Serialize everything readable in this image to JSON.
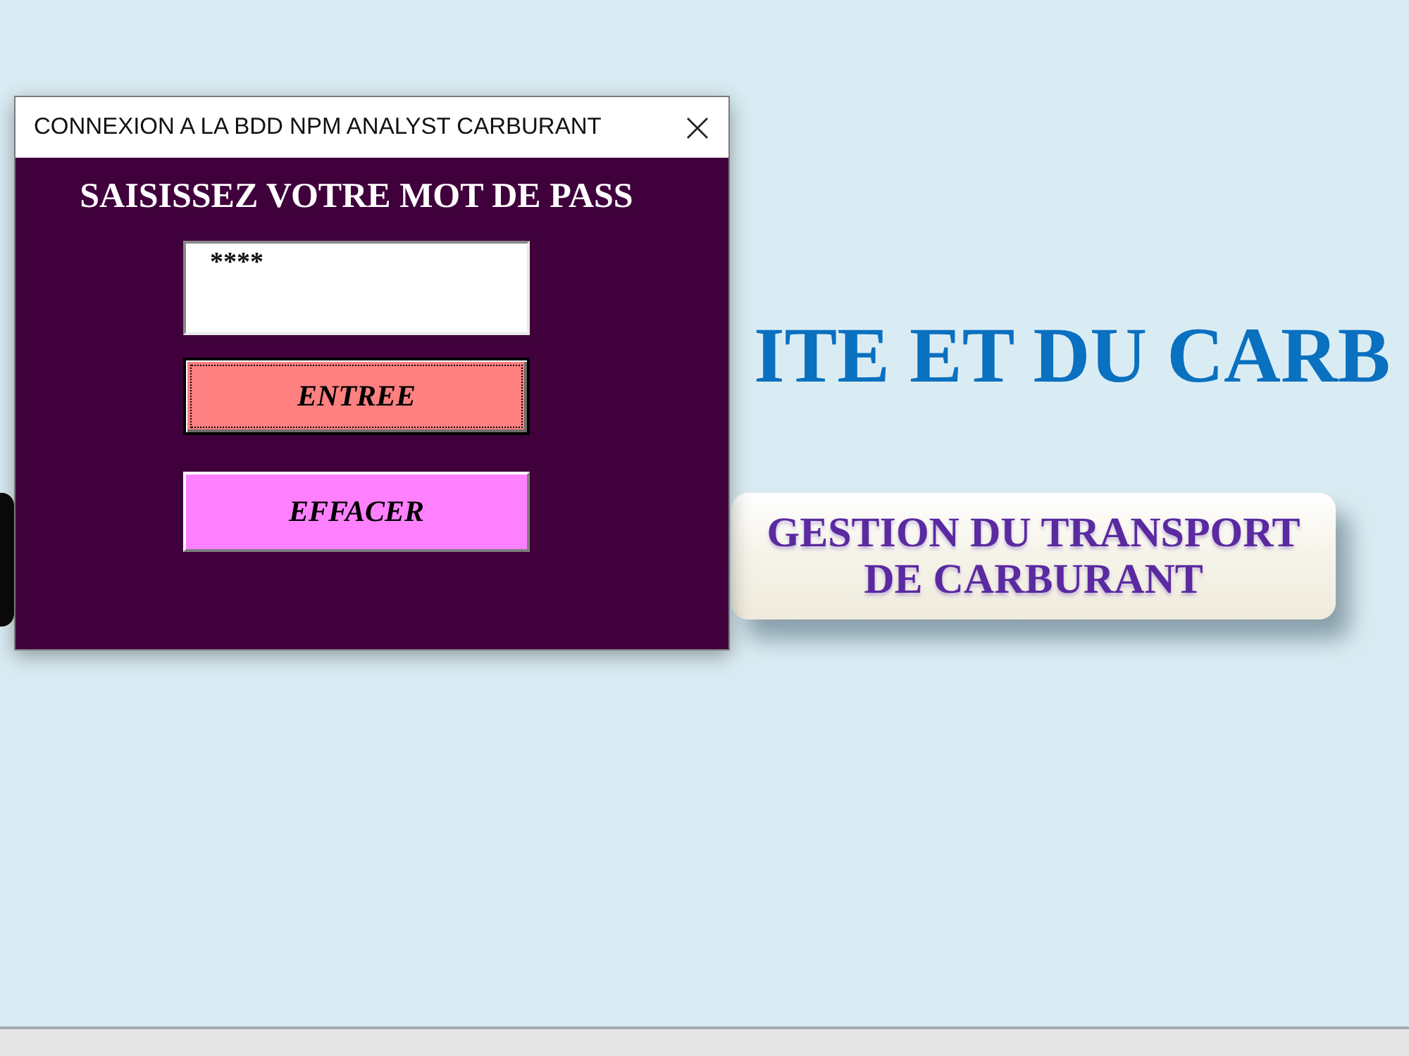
{
  "sheet": {
    "title": "ITE ET DU CARB",
    "buttons": [
      {
        "label": "GESTION DU TRANSPORT DE CARBURANT"
      }
    ]
  },
  "dialog": {
    "title": "CONNEXION A LA BDD NPM ANALYST CARBURANT",
    "prompt": "SAISISSEZ VOTRE MOT DE PASS",
    "password": {
      "value": "****"
    },
    "buttons": [
      {
        "label": "ENTREE",
        "color": "#ff8080",
        "focused": true
      },
      {
        "label": "EFFACER",
        "color": "#ff80ff",
        "focused": false
      }
    ]
  }
}
